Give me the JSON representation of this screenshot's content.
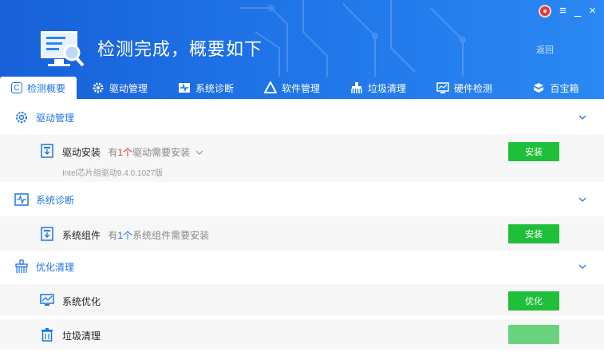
{
  "header": {
    "title": "检测完成，概要如下",
    "back_label": "返回"
  },
  "window_controls": {
    "menu_icon": "≡",
    "minimize_icon": "_",
    "close_icon": "×"
  },
  "tabs": [
    {
      "label": "检测概要",
      "icon": "refresh-icon",
      "active": true
    },
    {
      "label": "驱动管理",
      "icon": "gear-icon",
      "active": false
    },
    {
      "label": "系统诊断",
      "icon": "diagnosis-icon",
      "active": false
    },
    {
      "label": "软件管理",
      "icon": "triangle-icon",
      "active": false
    },
    {
      "label": "垃圾清理",
      "icon": "broom-icon",
      "active": false
    },
    {
      "label": "硬件检测",
      "icon": "monitor-icon",
      "active": false
    },
    {
      "label": "百宝箱",
      "icon": "toolbox-icon",
      "active": false
    }
  ],
  "sections": {
    "driver": {
      "title": "驱动管理",
      "item": {
        "label": "驱动安装",
        "note_prefix": "有",
        "note_count": "1个",
        "note_suffix": "驱动需要安装",
        "sub": "Intel芯片组驱动9.4.0.1027版",
        "button": "安装"
      }
    },
    "diagnosis": {
      "title": "系统诊断",
      "item": {
        "label": "系统组件",
        "note_prefix": "有",
        "note_count": "1个",
        "note_suffix": "系统组件需要安装",
        "button": "安装"
      }
    },
    "cleanup": {
      "title": "优化清理",
      "items": [
        {
          "label": "系统优化",
          "button": "优化"
        },
        {
          "label": "垃圾清理"
        }
      ]
    }
  },
  "colors": {
    "header_blue": "#1f74e8",
    "accent_blue": "#1f74e8",
    "button_green": "#1fbf3a",
    "warn_red": "#e8312c"
  }
}
